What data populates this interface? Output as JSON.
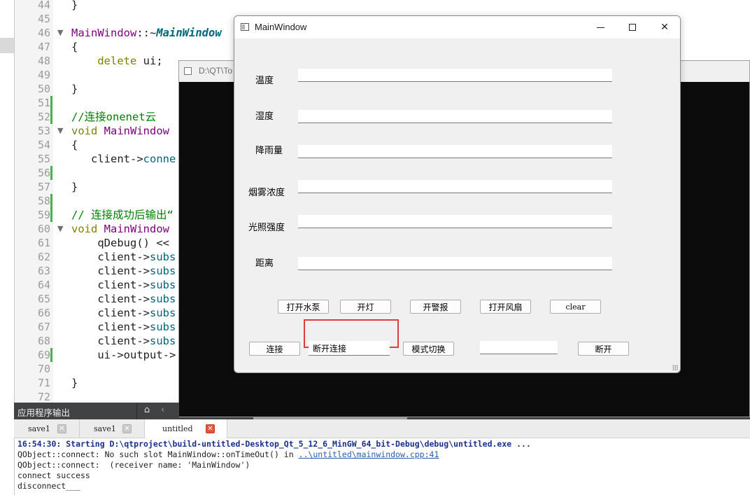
{
  "editor": {
    "lines": [
      {
        "n": "44",
        "parts": [
          {
            "t": "}",
            "c": "op"
          }
        ]
      },
      {
        "n": "45",
        "parts": []
      },
      {
        "n": "46",
        "parts": [
          {
            "t": "MainWindow",
            "c": "ty"
          },
          {
            "t": "::~",
            "c": "op"
          },
          {
            "t": "MainWindow",
            "c": "it"
          }
        ]
      },
      {
        "n": "47",
        "parts": [
          {
            "t": "{",
            "c": "op"
          }
        ]
      },
      {
        "n": "48",
        "parts": [
          {
            "t": "    delete",
            "c": "kw"
          },
          {
            "t": " ui;",
            "c": "op"
          }
        ]
      },
      {
        "n": "49",
        "parts": []
      },
      {
        "n": "50",
        "parts": [
          {
            "t": "}",
            "c": "op"
          }
        ]
      },
      {
        "n": "51",
        "parts": []
      },
      {
        "n": "52",
        "parts": [
          {
            "t": "//连接onenet云",
            "c": "cm"
          }
        ]
      },
      {
        "n": "53",
        "parts": [
          {
            "t": "void",
            "c": "kw"
          },
          {
            "t": " MainWindow",
            "c": "ty"
          }
        ]
      },
      {
        "n": "54",
        "parts": [
          {
            "t": "{",
            "c": "op"
          }
        ]
      },
      {
        "n": "55",
        "parts": [
          {
            "t": "   client->",
            "c": "op"
          },
          {
            "t": "conne",
            "c": "fn"
          }
        ]
      },
      {
        "n": "56",
        "parts": []
      },
      {
        "n": "57",
        "parts": [
          {
            "t": "}",
            "c": "op"
          }
        ]
      },
      {
        "n": "58",
        "parts": []
      },
      {
        "n": "59",
        "parts": [
          {
            "t": "// 连接成功后输出“",
            "c": "cm"
          }
        ]
      },
      {
        "n": "60",
        "parts": [
          {
            "t": "void",
            "c": "kw"
          },
          {
            "t": " MainWindow",
            "c": "ty"
          }
        ]
      },
      {
        "n": "61",
        "parts": [
          {
            "t": "    qDebug() <<",
            "c": "op"
          }
        ]
      },
      {
        "n": "62",
        "parts": [
          {
            "t": "    client->",
            "c": "op"
          },
          {
            "t": "subs",
            "c": "fn"
          }
        ]
      },
      {
        "n": "63",
        "parts": [
          {
            "t": "    client->",
            "c": "op"
          },
          {
            "t": "subs",
            "c": "fn"
          }
        ]
      },
      {
        "n": "64",
        "parts": [
          {
            "t": "    client->",
            "c": "op"
          },
          {
            "t": "subs",
            "c": "fn"
          }
        ]
      },
      {
        "n": "65",
        "parts": [
          {
            "t": "    client->",
            "c": "op"
          },
          {
            "t": "subs",
            "c": "fn"
          }
        ]
      },
      {
        "n": "66",
        "parts": [
          {
            "t": "    client->",
            "c": "op"
          },
          {
            "t": "subs",
            "c": "fn"
          }
        ]
      },
      {
        "n": "67",
        "parts": [
          {
            "t": "    client->",
            "c": "op"
          },
          {
            "t": "subs",
            "c": "fn"
          }
        ]
      },
      {
        "n": "68",
        "parts": [
          {
            "t": "    client->",
            "c": "op"
          },
          {
            "t": "subs",
            "c": "fn"
          }
        ]
      },
      {
        "n": "69",
        "parts": [
          {
            "t": "    ui->output->",
            "c": "op"
          }
        ]
      },
      {
        "n": "70",
        "parts": []
      },
      {
        "n": "71",
        "parts": [
          {
            "t": "}",
            "c": "op"
          }
        ]
      },
      {
        "n": "72",
        "parts": []
      }
    ]
  },
  "console_window": {
    "title": "D:\\QT\\To"
  },
  "main_window": {
    "title": "MainWindow",
    "fields": [
      {
        "label": "温度",
        "value": ""
      },
      {
        "label": "湿度",
        "value": ""
      },
      {
        "label": "降雨量",
        "value": ""
      },
      {
        "label": "烟雾浓度",
        "value": ""
      },
      {
        "label": "光照强度",
        "value": ""
      },
      {
        "label": "距离",
        "value": ""
      }
    ],
    "control_buttons": [
      "打开水泵",
      "开灯",
      "开警报",
      "打开风扇",
      "clear"
    ],
    "connect_button": "连接",
    "status_field_value": "断开连接",
    "mode_button": "模式切换",
    "extra_field_value": "",
    "disconnect_button": "断开"
  },
  "output_pane": {
    "header": "应用程序输出",
    "tabs": [
      {
        "label": "save1",
        "active": false
      },
      {
        "label": "save1",
        "active": false
      },
      {
        "label": "untitled",
        "active": true
      }
    ],
    "lines": [
      {
        "text": "16:54:30: Starting D:\\qtproject\\build-untitled-Desktop_Qt_5_12_6_MinGW_64_bit-Debug\\debug\\untitled.exe ...",
        "bold": true
      },
      {
        "text": "QObject::connect: No such slot MainWindow::onTimeOut() in ",
        "link": "..\\untitled\\mainwindow.cpp:41",
        "bold": false
      },
      {
        "text": "QObject::connect:  (receiver name: 'MainWindow')",
        "bold": false
      },
      {
        "text": "connect success",
        "bold": false
      },
      {
        "text": "disconnect___",
        "bold": false
      }
    ]
  }
}
